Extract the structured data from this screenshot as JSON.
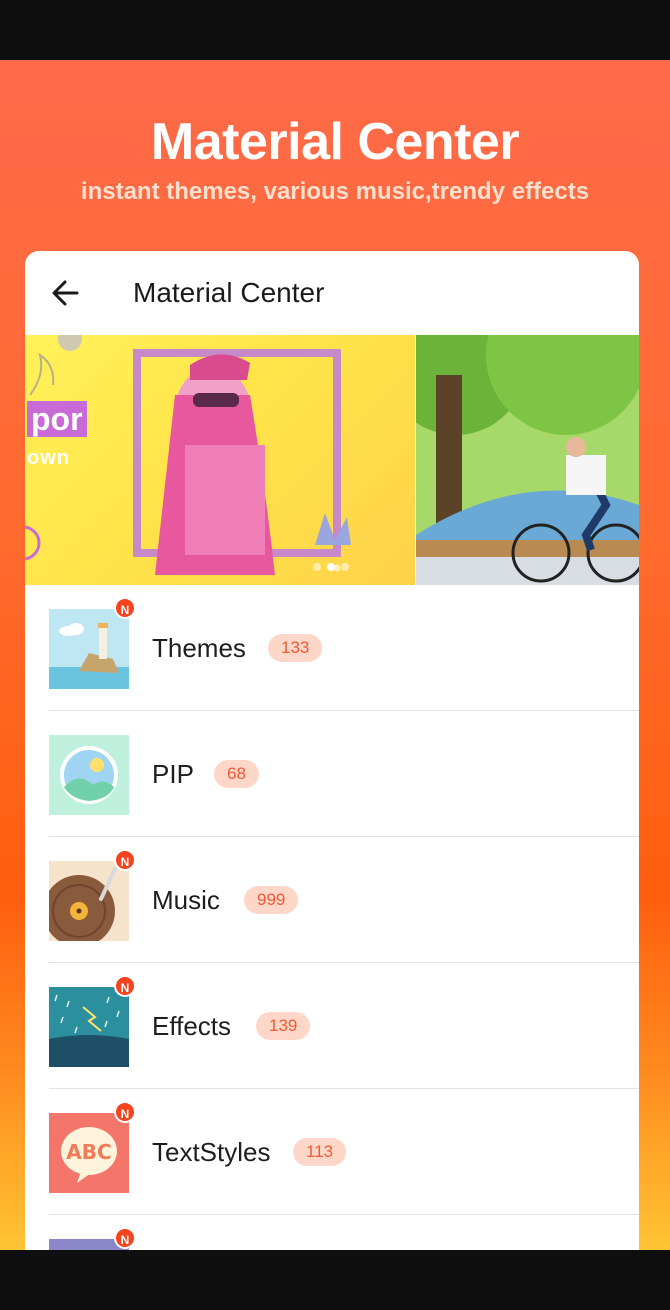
{
  "promo": {
    "title": "Material Center",
    "subtitle": "instant themes, various music,trendy effects"
  },
  "appbar": {
    "back_icon": "arrow-left-icon",
    "title": "Material Center"
  },
  "banner": {
    "slide_text": "por",
    "slide_text2": "own",
    "active_dot": 2,
    "dot_count": 3
  },
  "items": [
    {
      "label": "Themes",
      "count": "133",
      "is_new": true,
      "icon": "lighthouse-thumbnail"
    },
    {
      "label": "PIP",
      "count": "68",
      "is_new": false,
      "icon": "image-frame-thumbnail"
    },
    {
      "label": "Music",
      "count": "999",
      "is_new": true,
      "icon": "vinyl-record-thumbnail"
    },
    {
      "label": "Effects",
      "count": "139",
      "is_new": true,
      "icon": "rain-lightning-thumbnail"
    },
    {
      "label": "TextStyles",
      "count": "113",
      "is_new": true,
      "icon": "abc-bubble-thumbnail"
    },
    {
      "label": "",
      "count": "",
      "is_new": true,
      "icon": "partial-thumbnail"
    }
  ],
  "new_badge_text": "N",
  "colors": {
    "accent": "#f4431f",
    "count_bg": "#ffd7c8",
    "count_text": "#f05a36"
  }
}
